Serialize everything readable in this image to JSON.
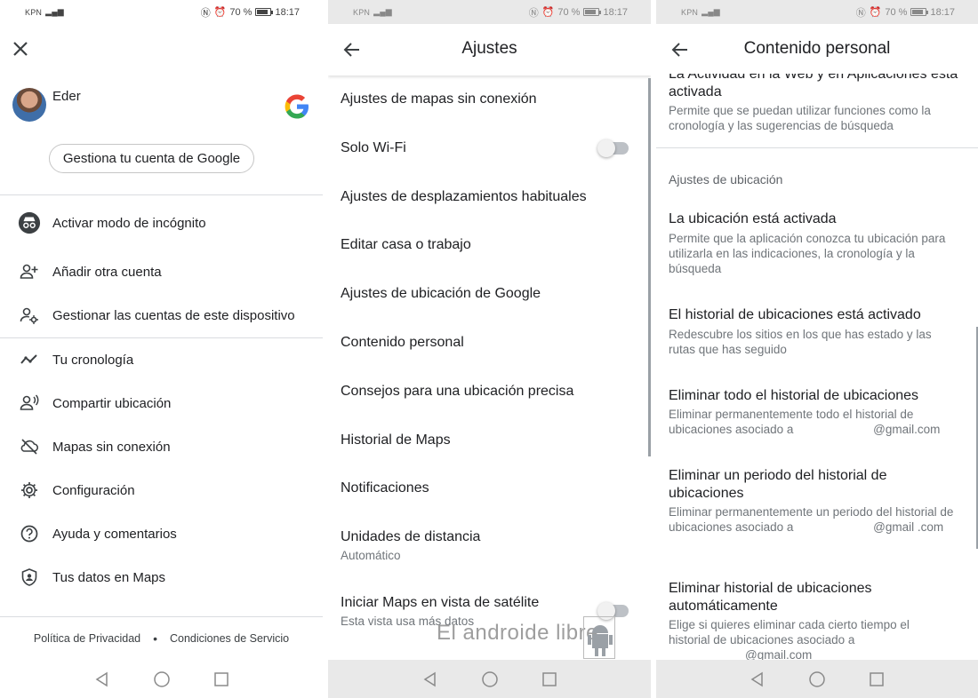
{
  "status": {
    "carrier": "KPN",
    "battery": "70 %",
    "time": "18:17"
  },
  "panel1": {
    "user_name": "Eder",
    "manage_button": "Gestiona tu cuenta de Google",
    "menu": [
      {
        "label": "Activar modo de incógnito",
        "icon": "incognito-icon"
      },
      {
        "label": "Añadir otra cuenta",
        "icon": "add-person-icon"
      },
      {
        "label": "Gestionar las cuentas de este dispositivo",
        "icon": "manage-accounts-icon"
      },
      {
        "label": "Tu cronología",
        "icon": "timeline-icon"
      },
      {
        "label": "Compartir ubicación",
        "icon": "share-location-icon"
      },
      {
        "label": "Mapas sin conexión",
        "icon": "offline-maps-icon"
      },
      {
        "label": "Configuración",
        "icon": "gear-icon"
      },
      {
        "label": "Ayuda y comentarios",
        "icon": "help-icon"
      },
      {
        "label": "Tus datos en Maps",
        "icon": "shield-person-icon"
      }
    ],
    "footer": {
      "privacy": "Política de Privacidad",
      "separator": "•",
      "terms": "Condiciones de Servicio"
    }
  },
  "panel2": {
    "title": "Ajustes",
    "items": [
      {
        "label": "Ajustes de mapas sin conexión"
      },
      {
        "label": "Solo Wi-Fi",
        "toggle": false
      },
      {
        "label": "Ajustes de desplazamientos habituales"
      },
      {
        "label": "Editar casa o trabajo"
      },
      {
        "label": "Ajustes de ubicación de Google"
      },
      {
        "label": "Contenido personal"
      },
      {
        "label": "Consejos para una ubicación precisa"
      },
      {
        "label": "Historial de Maps"
      },
      {
        "label": "Notificaciones"
      },
      {
        "label": "Unidades de distancia",
        "sub": "Automático"
      },
      {
        "label": "Iniciar Maps en vista de satélite",
        "sub": "Esta vista usa más datos",
        "toggle": false
      }
    ],
    "watermark": "El androide libre"
  },
  "panel3": {
    "title": "Contenido personal",
    "web_activity": {
      "title": "La Actividad en la Web y en Aplicaciones está activada",
      "sub": "Permite que se puedan utilizar funciones como la cronología y las sugerencias de búsqueda"
    },
    "section": "Ajustes de ubicación",
    "items": [
      {
        "title": "La ubicación está activada",
        "sub": "Permite que la aplicación conozca tu ubicación para utilizarla en las indicaciones, la cronología y la búsqueda"
      },
      {
        "title": "El historial de ubicaciones está activado",
        "sub": "Redescubre los sitios en los que has estado y las rutas que has seguido"
      },
      {
        "title": "Eliminar todo el historial de ubicaciones",
        "sub_a": "Eliminar permanentemente todo el historial de ubicaciones asociado a",
        "sub_b": "@gmail.com"
      },
      {
        "title": "Eliminar un periodo del historial de ubicaciones",
        "sub_a": "Eliminar permanentemente un periodo del historial de ubicaciones asociado a",
        "sub_b": "@gmail .com"
      },
      {
        "title": "Eliminar historial de ubicaciones automáticamente",
        "sub_a": "Elige si quieres eliminar cada cierto tiempo el historial de ubicaciones asociado a",
        "sub_b": "@gmail.com"
      }
    ]
  }
}
